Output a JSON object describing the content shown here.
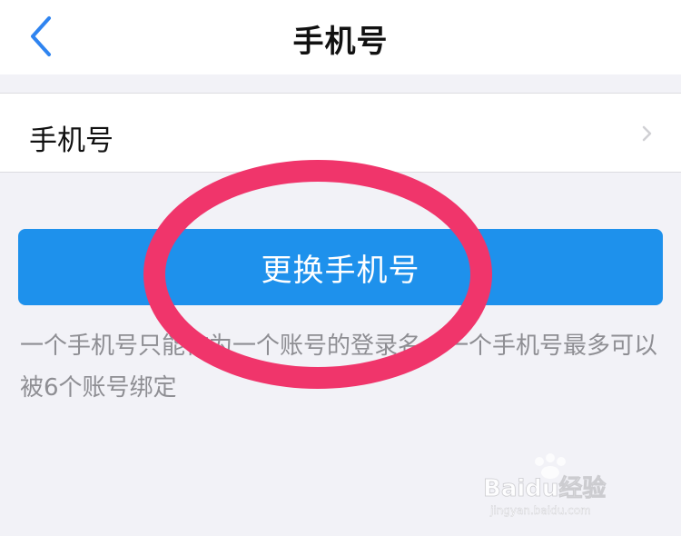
{
  "navbar": {
    "title": "手机号"
  },
  "phone_row": {
    "label": "手机号",
    "value": ""
  },
  "change_button": {
    "label": "更换手机号"
  },
  "hint": {
    "text": "一个手机号只能作为一个账号的登录名，一个手机号最多可以被6个账号绑定"
  },
  "annotation": {
    "color": "#f0356b"
  },
  "watermark": {
    "brand": "Baidu经验",
    "url": "jingyan.baidu.com"
  },
  "colors": {
    "accent_blue": "#1e91ec",
    "back_arrow": "#2f84f0",
    "background": "#f2f2f7",
    "hint_text": "#8e8e93"
  },
  "icons": {
    "back": "chevron-left-icon",
    "row_chevron": "chevron-right-icon"
  }
}
